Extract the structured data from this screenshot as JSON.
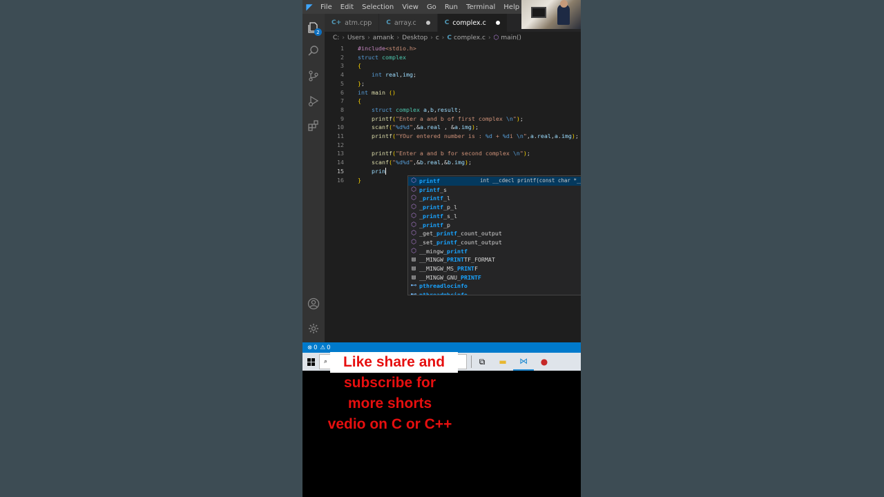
{
  "menu": [
    "File",
    "Edit",
    "Selection",
    "View",
    "Go",
    "Run",
    "Terminal",
    "Help"
  ],
  "activity_badge": "2",
  "tabs": [
    {
      "label": "atm.cpp",
      "glyph": "C+",
      "modified": false,
      "active": false
    },
    {
      "label": "array.c",
      "glyph": "C",
      "modified": true,
      "active": false
    },
    {
      "label": "complex.c",
      "glyph": "C",
      "modified": true,
      "active": true
    }
  ],
  "breadcrumb": {
    "parts": [
      "C:",
      "Users",
      "amank",
      "Desktop",
      "c"
    ],
    "file": "complex.c",
    "symbol": "main()"
  },
  "code_lines": [
    {
      "n": "1",
      "text": "#include<stdio.h>"
    },
    {
      "n": "2",
      "text": "struct complex"
    },
    {
      "n": "3",
      "text": "{"
    },
    {
      "n": "4",
      "text": "    int real,img;"
    },
    {
      "n": "5",
      "text": "};"
    },
    {
      "n": "6",
      "text": "int main ()"
    },
    {
      "n": "7",
      "text": "{"
    },
    {
      "n": "8",
      "text": "    struct complex a,b,result;"
    },
    {
      "n": "9",
      "text": "    printf(\"Enter a and b of first complex \\n\");"
    },
    {
      "n": "10",
      "text": "    scanf(\"%d%d\",&a.real , &a.img);"
    },
    {
      "n": "11",
      "text": "    printf(\"YOur entered number is : %d + %di \\n\",a.real,a.img);"
    },
    {
      "n": "12",
      "text": ""
    },
    {
      "n": "13",
      "text": "    printf(\"Enter a and b for second complex \\n\");"
    },
    {
      "n": "14",
      "text": "    scanf(\"%d%d\",&b.real,&b.img);"
    },
    {
      "n": "15",
      "text": "    prin"
    },
    {
      "n": "16",
      "text": "}"
    }
  ],
  "suggestions": [
    {
      "kind": "method",
      "match": "printf",
      "rest": "",
      "detail": "int __cdecl printf(const char *__restrict__ _Format, ...)",
      "selected": true
    },
    {
      "kind": "method",
      "match": "printf",
      "rest": "_s",
      "prefix": "",
      "detail": ""
    },
    {
      "kind": "method",
      "prefix": "_",
      "match": "printf",
      "rest": "_l",
      "detail": ""
    },
    {
      "kind": "method",
      "prefix": "_",
      "match": "printf",
      "rest": "_p_l",
      "detail": ""
    },
    {
      "kind": "method",
      "prefix": "_",
      "match": "printf",
      "rest": "_s_l",
      "detail": ""
    },
    {
      "kind": "method",
      "prefix": "_",
      "match": "printf",
      "rest": "_p",
      "detail": ""
    },
    {
      "kind": "method",
      "prefix": "_get_",
      "match": "printf",
      "rest": "_count_output",
      "detail": ""
    },
    {
      "kind": "method",
      "prefix": "_set_",
      "match": "printf",
      "rest": "_count_output",
      "detail": ""
    },
    {
      "kind": "method",
      "prefix": "__mingw_",
      "match": "printf",
      "rest": "",
      "detail": ""
    },
    {
      "kind": "constant",
      "prefix": "__MINGW_",
      "match": "PRINT",
      "rest": "TF_FORMAT",
      "detail": ""
    },
    {
      "kind": "constant",
      "prefix": "__MINGW_MS_",
      "match": "PRINT",
      "rest": "F",
      "detail": ""
    },
    {
      "kind": "constant",
      "prefix": "__MINGW_GNU_",
      "match": "PRINTF",
      "rest": "",
      "detail": ""
    },
    {
      "kind": "type",
      "prefix": "",
      "match": "pthreadlocinfo",
      "rest": "",
      "detail": ""
    },
    {
      "kind": "type",
      "prefix": "",
      "match": "pthreadmbcinfo",
      "rest": "",
      "detail": ""
    }
  ],
  "status": {
    "errors": "0",
    "warnings": "0"
  },
  "overlay_lines": [
    "Like share and",
    "subscribe for",
    "more shorts",
    "vedio on C or C++"
  ],
  "colors": {
    "accent": "#007acc",
    "overlay_text": "#e60f0f",
    "editor_bg": "#1e1e1e"
  }
}
